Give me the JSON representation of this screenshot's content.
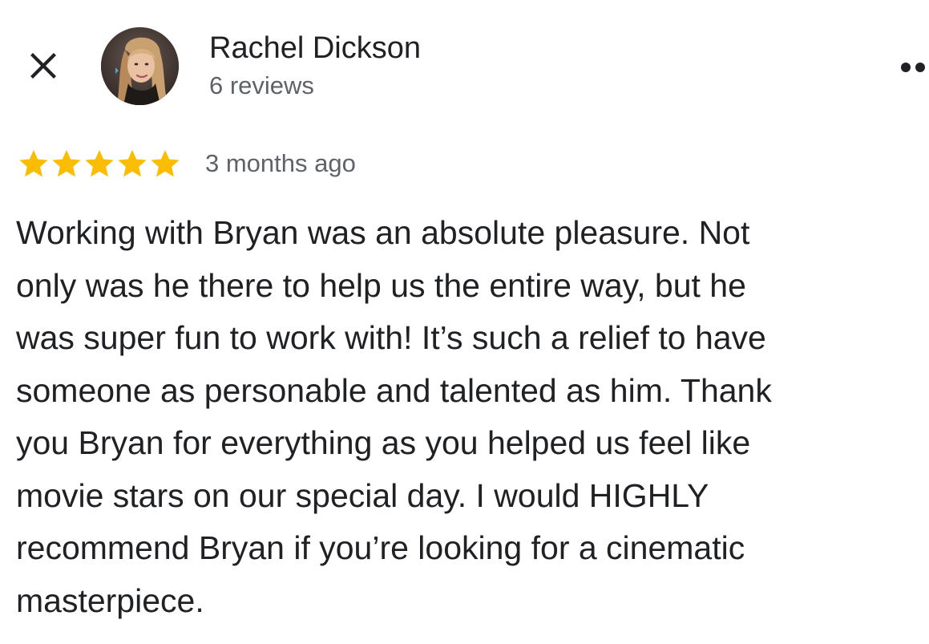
{
  "header": {
    "close_icon": "close-icon",
    "more_icon": "more-options-icon"
  },
  "reviewer": {
    "name": "Rachel Dickson",
    "reviews_count": "6 reviews"
  },
  "review": {
    "rating": 5,
    "rating_max": 5,
    "star_color": "#fbbc04",
    "date": "3 months ago",
    "lines": [
      "Working with Bryan was an absolute pleasure. Not",
      "only was he there to help us the entire way, but he",
      "was super fun to work with! It’s such a relief to have",
      "someone as personable and talented as him. Thank",
      "you Bryan for everything as you helped us feel like",
      "movie stars on our special day. I would HIGHLY",
      "recommend Bryan if you’re looking for a cinematic",
      "masterpiece."
    ]
  }
}
